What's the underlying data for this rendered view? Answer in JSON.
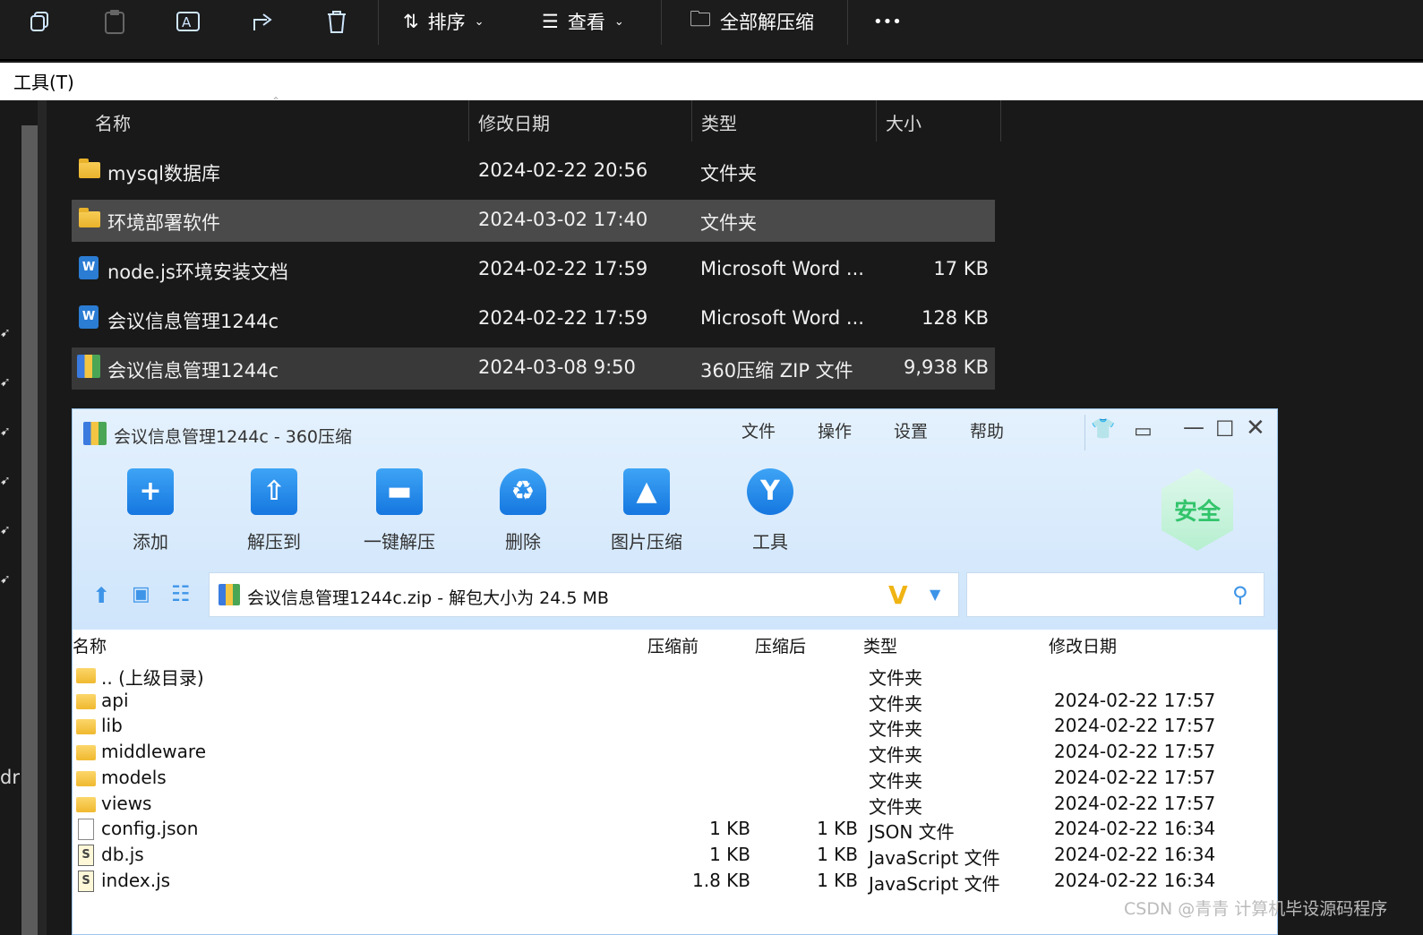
{
  "toolbar": {
    "sort_label": "排序",
    "view_label": "查看",
    "extract_all_label": "全部解压缩",
    "more_label": "•••"
  },
  "menu": {
    "tools_label": "工具(T)"
  },
  "explorer": {
    "columns": {
      "name": "名称",
      "modified": "修改日期",
      "type": "类型",
      "size": "大小"
    },
    "rows": [
      {
        "name": "mysql数据库",
        "modified": "2024-02-22 20:56",
        "type": "文件夹",
        "size": ""
      },
      {
        "name": "环境部署软件",
        "modified": "2024-03-02 17:40",
        "type": "文件夹",
        "size": ""
      },
      {
        "name": "node.js环境安装文档",
        "modified": "2024-02-22 17:59",
        "type": "Microsoft Word ...",
        "size": "17 KB"
      },
      {
        "name": "会议信息管理1244c",
        "modified": "2024-02-22 17:59",
        "type": "Microsoft Word ...",
        "size": "128 KB"
      },
      {
        "name": "会议信息管理1244c",
        "modified": "2024-03-08 9:50",
        "type": "360压缩 ZIP 文件",
        "size": "9,938 KB"
      }
    ],
    "left_edge_text": "dr"
  },
  "zipwin": {
    "title": "会议信息管理1244c - 360压缩",
    "menu": [
      "文件",
      "操作",
      "设置",
      "帮助"
    ],
    "tools": [
      "添加",
      "解压到",
      "一键解压",
      "删除",
      "图片压缩",
      "工具"
    ],
    "badge": "安全",
    "address": "会议信息管理1244c.zip - 解包大小为 24.5 MB",
    "columns": {
      "name": "名称",
      "before": "压缩前",
      "after": "压缩后",
      "type": "类型",
      "modified": "修改日期"
    },
    "files": [
      {
        "name": ".. (上级目录)",
        "before": "",
        "after": "",
        "type": "文件夹",
        "modified": "",
        "icon": "folder"
      },
      {
        "name": "api",
        "before": "",
        "after": "",
        "type": "文件夹",
        "modified": "2024-02-22 17:57",
        "icon": "folder"
      },
      {
        "name": "lib",
        "before": "",
        "after": "",
        "type": "文件夹",
        "modified": "2024-02-22 17:57",
        "icon": "folder"
      },
      {
        "name": "middleware",
        "before": "",
        "after": "",
        "type": "文件夹",
        "modified": "2024-02-22 17:57",
        "icon": "folder"
      },
      {
        "name": "models",
        "before": "",
        "after": "",
        "type": "文件夹",
        "modified": "2024-02-22 17:57",
        "icon": "folder"
      },
      {
        "name": "views",
        "before": "",
        "after": "",
        "type": "文件夹",
        "modified": "2024-02-22 17:57",
        "icon": "folder"
      },
      {
        "name": "config.json",
        "before": "1 KB",
        "after": "1 KB",
        "type": "JSON 文件",
        "modified": "2024-02-22 16:34",
        "icon": "file"
      },
      {
        "name": "db.js",
        "before": "1 KB",
        "after": "1 KB",
        "type": "JavaScript 文件",
        "modified": "2024-02-22 16:34",
        "icon": "js"
      },
      {
        "name": "index.js",
        "before": "1.8 KB",
        "after": "1 KB",
        "type": "JavaScript 文件",
        "modified": "2024-02-22 16:34",
        "icon": "js"
      }
    ]
  },
  "watermark": "CSDN @青青  计算机毕设源码程序"
}
